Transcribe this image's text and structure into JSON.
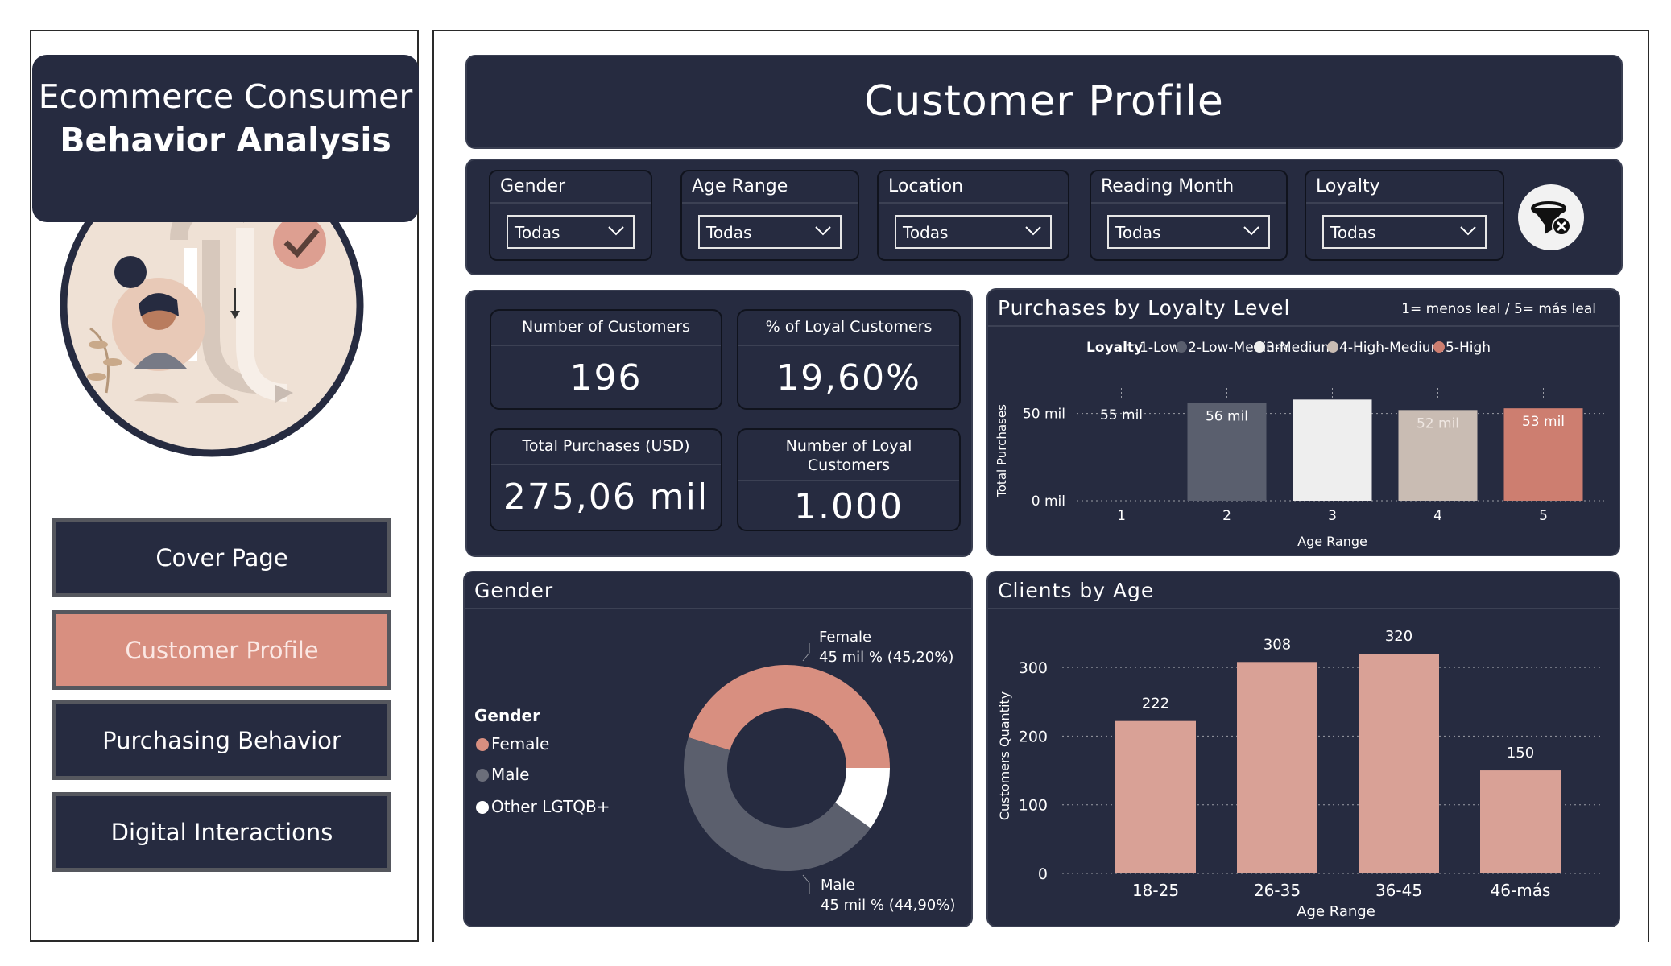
{
  "sidebar": {
    "title_line1": "Ecommerce Consumer",
    "title_line2": "Behavior Analysis",
    "nav": [
      {
        "label": "Cover Page",
        "active": false
      },
      {
        "label": "Customer Profile",
        "active": true
      },
      {
        "label": "Purchasing Behavior",
        "active": false
      },
      {
        "label": "Digital Interactions",
        "active": false
      }
    ]
  },
  "header": {
    "title": "Customer Profile"
  },
  "filters": [
    {
      "label": "Gender",
      "value": "Todas"
    },
    {
      "label": "Age Range",
      "value": "Todas"
    },
    {
      "label": "Location",
      "value": "Todas"
    },
    {
      "label": "Reading Month",
      "value": "Todas"
    },
    {
      "label": "Loyalty",
      "value": "Todas"
    }
  ],
  "kpis": [
    {
      "label": "Number of Customers",
      "value": "196"
    },
    {
      "label": "% of Loyal Customers",
      "value": "19,60%"
    },
    {
      "label": "Total Purchases (USD)",
      "value": "275,06 mil"
    },
    {
      "label": "Number of Loyal Customers",
      "value": "1.000"
    }
  ],
  "colors": {
    "navy": "#262b40",
    "accent": "#d88f80",
    "low": "#2f3447",
    "low_medium": "#5a5f6e",
    "medium": "#eeeeee",
    "high_medium": "#c9bcb3",
    "high": "#cd7e70",
    "age_bar": "#d9a196",
    "male": "#5b5f6d",
    "other": "#ffffff"
  },
  "chart_data": [
    {
      "type": "bar",
      "title": "Purchases by Loyalty Level",
      "note": "1= menos leal  / 5= más leal",
      "legend_title": "Loyalty",
      "legend": [
        "1-Low",
        "2-Low-Medium",
        "3-Medium",
        "4-High-Medium",
        "5-High"
      ],
      "categories": [
        "1",
        "2",
        "3",
        "4",
        "5"
      ],
      "values": [
        55,
        56,
        58,
        52,
        53
      ],
      "data_labels": [
        "55 mil",
        "56 mil",
        "",
        "52 mil",
        "53 mil"
      ],
      "xlabel": "Age Range",
      "ylabel": "Total Purchases",
      "yticks": [
        "0 mil",
        "50 mil"
      ],
      "ylim": [
        0,
        60
      ]
    },
    {
      "type": "pie",
      "title": "Gender",
      "legend_title": "Gender",
      "legend": [
        "Female",
        "Male",
        "Other LGTQB+"
      ],
      "values": [
        45.2,
        44.9,
        9.9
      ],
      "labels": [
        {
          "name": "Female",
          "detail": "45 mil % (45,20%)"
        },
        {
          "name": "Male",
          "detail": "45 mil % (44,90%)"
        }
      ]
    },
    {
      "type": "bar",
      "title": "Clients by Age",
      "categories": [
        "18-25",
        "26-35",
        "36-45",
        "46-más"
      ],
      "values": [
        222,
        308,
        320,
        150
      ],
      "xlabel": "Age Range",
      "ylabel": "Customers Quantity",
      "yticks": [
        0,
        100,
        200,
        300
      ],
      "ylim": [
        0,
        340
      ]
    }
  ]
}
